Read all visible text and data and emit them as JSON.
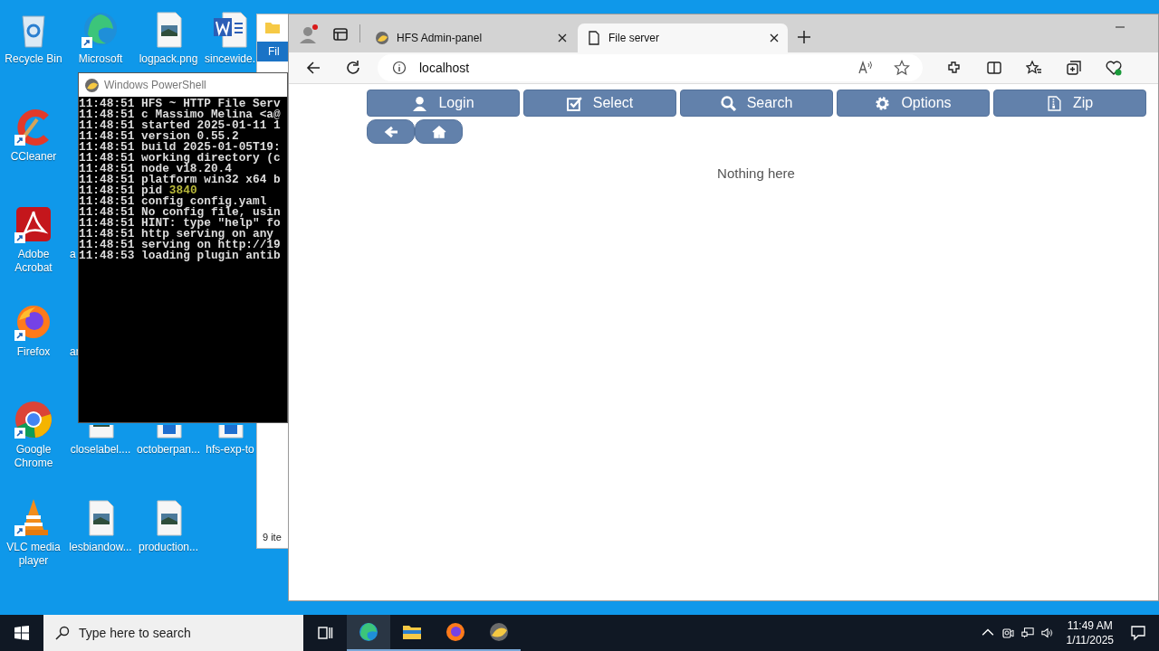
{
  "desktop": {
    "icons": [
      {
        "label": "Recycle Bin",
        "kind": "recycle"
      },
      {
        "label": "Microsoft",
        "kind": "edge"
      },
      {
        "label": "logpack.png",
        "kind": "image"
      },
      {
        "label": "sincewide.",
        "kind": "word"
      },
      {
        "label": "CCleaner",
        "kind": "ccleaner"
      },
      {
        "label": "Adobe Acrobat",
        "kind": "acrobat"
      },
      {
        "label": "a",
        "kind": "fragment"
      },
      {
        "label": "Firefox",
        "kind": "firefox"
      },
      {
        "label": "ar",
        "kind": "fragment"
      },
      {
        "label": "Google Chrome",
        "kind": "chrome"
      },
      {
        "label": "closelabel....",
        "kind": "image"
      },
      {
        "label": "octoberpan...",
        "kind": "doc"
      },
      {
        "label": "hfs-exp-to",
        "kind": "doc"
      },
      {
        "label": "VLC media player",
        "kind": "vlc"
      },
      {
        "label": "lesbiandow...",
        "kind": "image"
      },
      {
        "label": "production...",
        "kind": "image"
      }
    ]
  },
  "explorer": {
    "tab": "Fil",
    "status": "9 ite"
  },
  "powershell": {
    "title": "Windows PowerShell",
    "lines": [
      {
        "time": "11:48:51",
        "text": "HFS ~ HTTP File Serv"
      },
      {
        "time": "11:48:51",
        "text": "c Massimo Melina <a@"
      },
      {
        "time": "11:48:51",
        "text": "started 2025-01-11 1"
      },
      {
        "time": "11:48:51",
        "text": "version 0.55.2"
      },
      {
        "time": "11:48:51",
        "text": "build 2025-01-05T19:"
      },
      {
        "time": "11:48:51",
        "text": "working directory (c"
      },
      {
        "time": "11:48:51",
        "text": "node v18.20.4"
      },
      {
        "time": "11:48:51",
        "text": "platform win32 x64 b"
      },
      {
        "time": "11:48:51",
        "text": "pid ",
        "value": "3840"
      },
      {
        "time": "11:48:51",
        "text": "config config.yaml"
      },
      {
        "time": "11:48:51",
        "text": "No config file, usin"
      },
      {
        "time": "11:48:51",
        "text": "HINT: type \"help\" fo"
      },
      {
        "time": "11:48:51",
        "text": "http serving on any"
      },
      {
        "time": "11:48:51",
        "text": "serving on http://19"
      },
      {
        "time": "11:48:53",
        "text": "loading plugin antib"
      }
    ]
  },
  "browser": {
    "tabs": [
      {
        "title": "HFS Admin-panel",
        "kind": "hfs",
        "selected": false
      },
      {
        "title": "File server",
        "kind": "page",
        "selected": true
      }
    ],
    "address": "localhost",
    "page": {
      "buttons": [
        {
          "label": "Login",
          "kind": "login"
        },
        {
          "label": "Select",
          "kind": "select"
        },
        {
          "label": "Search",
          "kind": "search"
        },
        {
          "label": "Options",
          "kind": "options"
        },
        {
          "label": "Zip",
          "kind": "zip"
        }
      ],
      "nav": [
        {
          "kind": "back"
        },
        {
          "kind": "home"
        }
      ],
      "message": "Nothing here"
    }
  },
  "taskbar": {
    "search_placeholder": "Type here to search",
    "apps": [
      {
        "kind": "edge",
        "running": true,
        "active": true
      },
      {
        "kind": "explorer",
        "running": true,
        "active": false
      },
      {
        "kind": "firefox",
        "running": true,
        "active": false
      },
      {
        "kind": "hfs",
        "running": true,
        "active": false
      }
    ],
    "time": "11:49 AM",
    "date": "1/11/2025"
  }
}
